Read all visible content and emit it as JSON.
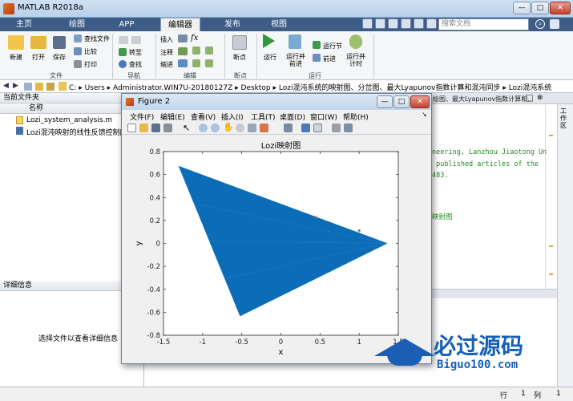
{
  "window": {
    "title": "MATLAB R2018a",
    "min": "—",
    "max": "□",
    "close": "✕"
  },
  "tabs": [
    "主页",
    "绘图",
    "APP",
    "编辑器",
    "发布",
    "视图"
  ],
  "active_tab": "编辑器",
  "search": {
    "placeholder": "搜索文档"
  },
  "ribbon": {
    "file": {
      "new": "新建",
      "open": "打开",
      "save": "保存",
      "find_files": "查找文件",
      "compare": "比较",
      "print": "打印",
      "group": "文件"
    },
    "nav": {
      "goto": "转至",
      "find": "查找",
      "group": "导航"
    },
    "edit": {
      "insert": "插入",
      "comment": "注释",
      "indent": "缩进",
      "fx": "fx",
      "group": "编辑"
    },
    "breakpoint": {
      "label": "断点",
      "group": "断点"
    },
    "run": {
      "run": "运行",
      "run_advance": "运行并\n前进",
      "run_section": "运行节",
      "advance": "前进",
      "run_time": "运行并\n计时",
      "group": "运行"
    }
  },
  "address": {
    "segments": [
      "C:",
      "Users",
      "Administrator.WIN7U-20180127Z",
      "Desktop",
      "Lozi混沌系统的映射图、分岔图、最大Lyapunov指数计算和混沌同步",
      "Lozi混沌系统"
    ]
  },
  "left_panel": {
    "title": "当前文件夹",
    "col_name": "名称",
    "files": [
      "Lozi_system_analysis.m",
      "Lozi混沌映射的线性反馈控制[1]."
    ],
    "details_title": "详细信息",
    "details_hint": "选择文件以查看详细信息"
  },
  "editor": {
    "lines": [
      "neering, Lanzhou Jiaotong Un",
      " published articles of the ",
      "483.",
      "",
      "",
      "映射图"
    ],
    "side_tab": "工作区",
    "overflow": "绘图、最大Lyapunov指数计算和..."
  },
  "status": {
    "row_label": "行",
    "row": "1",
    "col_label": "列",
    "col": "1"
  },
  "figure": {
    "title": "Figure 2",
    "menu": [
      "文件(F)",
      "编辑(E)",
      "查看(V)",
      "插入(I)",
      "工具(T)",
      "桌面(D)",
      "窗口(W)",
      "帮助(H)"
    ]
  },
  "chart_data": {
    "type": "scatter",
    "title": "Lozi映射图",
    "xlabel": "x",
    "ylabel": "y",
    "xlim": [
      -1.5,
      1.5
    ],
    "ylim": [
      -0.8,
      0.8
    ],
    "xticks": [
      "-1.5",
      "-1",
      "-0.5",
      "0",
      "0.5",
      "1",
      "1.5"
    ],
    "yticks": [
      "-0.8",
      "-0.6",
      "-0.4",
      "-0.2",
      "0",
      "0.2",
      "0.4",
      "0.6",
      "0.8"
    ],
    "attractor_outline": [
      [
        -1.3,
        0.67
      ],
      [
        1.35,
        0
      ],
      [
        -0.52,
        -0.63
      ]
    ],
    "fixed_points": [
      {
        "x": 0.45,
        "y": 0.22,
        "color": "#e8613a",
        "marker": "*"
      },
      {
        "x": 1.0,
        "y": 0.1,
        "color": "#222222",
        "marker": "*"
      }
    ],
    "colors": {
      "points": "#0b6db7"
    }
  },
  "watermark": {
    "text": "必过源码",
    "url": "Biguo100.com"
  }
}
